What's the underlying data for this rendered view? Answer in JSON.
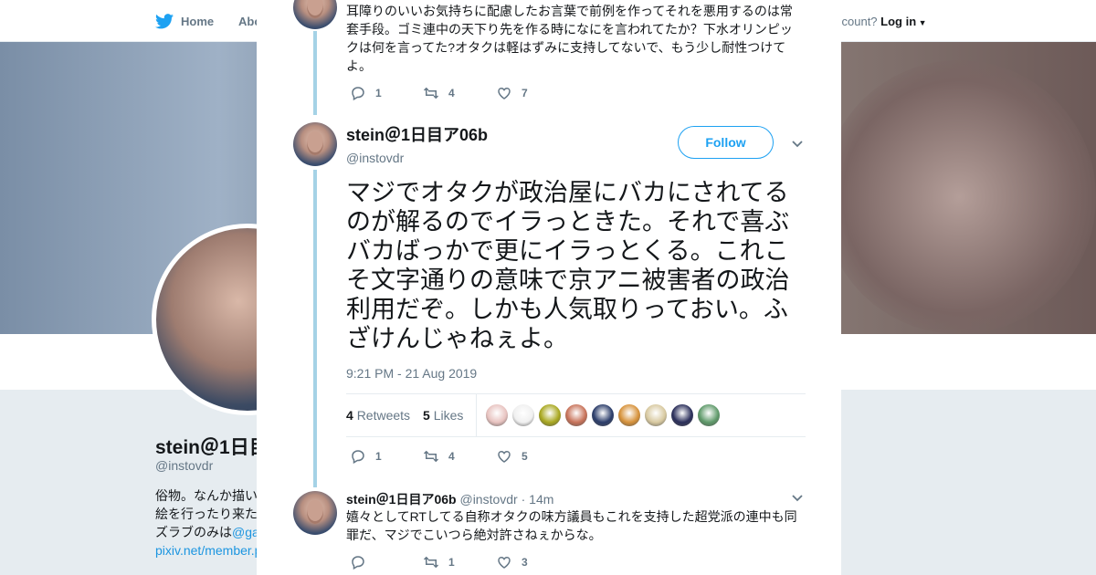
{
  "background": {
    "nav": {
      "home_label": "Home",
      "about_label": "Abo",
      "account_text": "ccount?",
      "login_label": "Log in"
    },
    "profile": {
      "name": "stein＠1日目",
      "handle": "@instovdr",
      "bio_line1": "俗物。なんか描い",
      "bio_line2": "絵を行ったり来た",
      "bio_line3_text": "ズラブのみは",
      "bio_line3_link": "@ga",
      "bio_line4_link": "pixiv.net/member.p"
    },
    "colors": {
      "accent": "#1da1f2",
      "banner": "#8b7d78"
    }
  },
  "close_icon": "close-icon",
  "previous_tweet": {
    "text": "耳障りのいいお気持ちに配慮したお言葉で前例を作ってそれを悪用するのは常套手段。ゴミ連中の天下り先を作る時になにを言われてたか？下水オリンピックは何を言ってた?オタクは軽はずみに支持してないで、もう少し耐性つけてよ。",
    "replies": "1",
    "retweets": "4",
    "likes": "7"
  },
  "main_tweet": {
    "name": "stein＠1日目ア06b",
    "handle": "@instovdr",
    "follow_label": "Follow",
    "text": "マジでオタクが政治屋にバカにされてるのが解るのでイラっときた。それで喜ぶバカばっかで更にイラっとくる。これこそ文字通りの意味で京アニ被害者の政治利用だぞ。しかも人気取りっておい。ふざけんじゃねぇよ。",
    "timestamp": "9:21 PM - 21 Aug 2019",
    "retweets_count": "4",
    "retweets_label": "Retweets",
    "likes_count": "5",
    "likes_label": "Likes",
    "liker_colors": [
      "#e8c3c0",
      "#f0f0f0",
      "#a9a820",
      "#c8735a",
      "#2b3d6a",
      "#d7923a",
      "#d8c9a0",
      "#2a2e5a",
      "#5f9a6a"
    ],
    "replies": "1",
    "retweets": "4",
    "likes": "5"
  },
  "reply_tweet": {
    "name": "stein＠1日目ア06b",
    "handle": "@instovdr",
    "time": "· 14m",
    "text": "嬉々としてRTしてる自称オタクの味方議員もこれを支持した超党派の連中も同罪だ、マジでこいつら絶対許さねぇからな。",
    "replies": "",
    "retweets": "1",
    "likes": "3"
  }
}
